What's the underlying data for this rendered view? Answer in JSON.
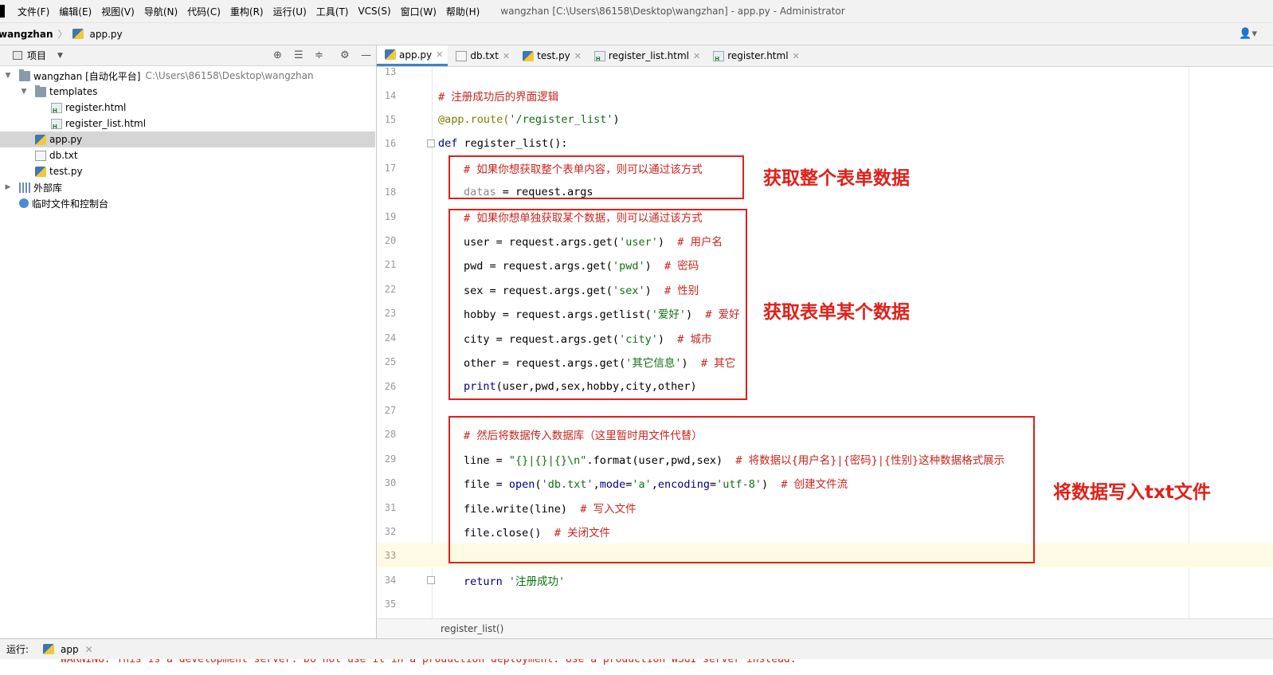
{
  "menubar": {
    "items": [
      "文件(F)",
      "编辑(E)",
      "视图(V)",
      "导航(N)",
      "代码(C)",
      "重构(R)",
      "运行(U)",
      "工具(T)",
      "VCS(S)",
      "窗口(W)",
      "帮助(H)"
    ],
    "window_title": "wangzhan [C:\\Users\\86158\\Desktop\\wangzhan] - app.py - Administrator"
  },
  "navbar": {
    "root": "wangzhan",
    "file": "app.py"
  },
  "project": {
    "title": "项目",
    "tree": [
      {
        "label": "wangzhan [自动化平台]",
        "path": "C:\\Users\\86158\\Desktop\\wangzhan"
      },
      {
        "label": "templates"
      },
      {
        "label": "register.html"
      },
      {
        "label": "register_list.html"
      },
      {
        "label": "app.py"
      },
      {
        "label": "db.txt"
      },
      {
        "label": "test.py"
      },
      {
        "label": "外部库"
      },
      {
        "label": "临时文件和控制台"
      }
    ]
  },
  "tabs": [
    "app.py",
    "db.txt",
    "test.py",
    "register_list.html",
    "register.html"
  ],
  "editor": {
    "line_numbers": [
      "13",
      "14",
      "15",
      "16",
      "17",
      "18",
      "19",
      "20",
      "21",
      "22",
      "23",
      "24",
      "25",
      "26",
      "27",
      "28",
      "29",
      "30",
      "31",
      "32",
      "33",
      "34",
      "35"
    ],
    "lines": {
      "l14": "# 注册成功后的界面逻辑",
      "l15_deco": "@app.route(",
      "l15_str": "'/register_list'",
      "l15_end": ")",
      "l16_kw": "def ",
      "l16_rest": "register_list():",
      "l17": "# 如果你想获取整个表单内容，则可以通过该方式",
      "l18_dim": "datas",
      "l18_rest": " = request.args",
      "l19": "# 如果你想单独获取某个数据，则可以通过该方式",
      "l20_a": "user = request.args.get(",
      "l20_s": "'user'",
      "l20_b": ")  ",
      "l20_c": "# 用户名",
      "l21_a": "pwd = request.args.get(",
      "l21_s": "'pwd'",
      "l21_b": ")  ",
      "l21_c": "# 密码",
      "l22_a": "sex = request.args.get(",
      "l22_s": "'sex'",
      "l22_b": ")  ",
      "l22_c": "# 性别",
      "l23_a": "hobby = request.args.getlist(",
      "l23_s": "'爱好'",
      "l23_b": ")  ",
      "l23_c": "# 爱好",
      "l24_a": "city = request.args.get(",
      "l24_s": "'city'",
      "l24_b": ")  ",
      "l24_c": "# 城市",
      "l25_a": "other = request.args.get(",
      "l25_s": "'其它信息'",
      "l25_b": ")  ",
      "l25_c": "# 其它",
      "l26_kw": "print",
      "l26_rest": "(user,pwd,sex,hobby,city,other)",
      "l28": "# 然后将数据传入数据库（这里暂时用文件代替）",
      "l29_a": "line = ",
      "l29_s": "\"{}|{}|{}\\n\"",
      "l29_b": ".format(user,pwd,sex)  ",
      "l29_c": "# 将数据以{用户名}|{密码}|{性别}这种数据格式展示",
      "l30_a": "file = ",
      "l30_kw": "open",
      "l30_b": "(",
      "l30_s1": "'db.txt'",
      "l30_c": ",",
      "l30_p1": "mode",
      "l30_d": "=",
      "l30_s2": "'a'",
      "l30_e": ",",
      "l30_p2": "encoding",
      "l30_f": "=",
      "l30_s3": "'utf-8'",
      "l30_g": ")  ",
      "l30_cm": "# 创建文件流",
      "l31_a": "file.write(line)  ",
      "l31_c": "# 写入文件",
      "l32_a": "file.close()  ",
      "l32_c": "# 关闭文件",
      "l34_kw": "return ",
      "l34_s": "'注册成功'"
    }
  },
  "annotations": {
    "whole_form": "获取整个表单数据",
    "single_field": "获取表单某个数据",
    "write_txt": "将数据写入txt文件"
  },
  "editor_breadcrumb": "register_list()",
  "runbar": {
    "label": "运行:",
    "tab": "app"
  },
  "console": {
    "text": "WARNING: This is a development server. Do not use it in a production deployment. Use a production WSGI server instead."
  }
}
